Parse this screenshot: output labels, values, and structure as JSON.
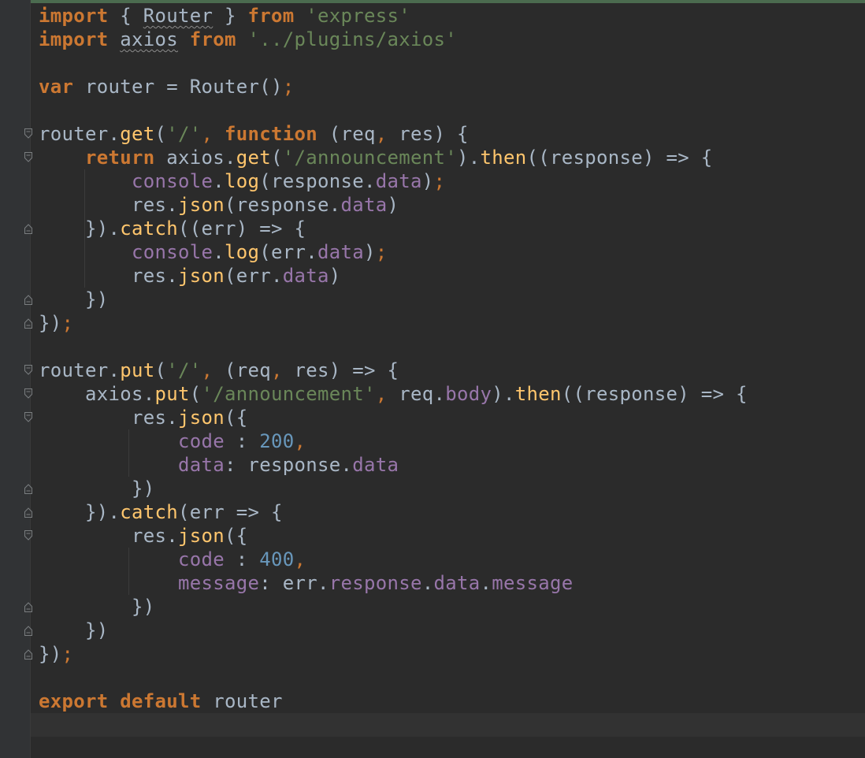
{
  "editor": {
    "lines": [
      [
        {
          "t": "import",
          "c": "kw"
        },
        {
          "t": " { "
        },
        {
          "t": "Router",
          "c": "typo"
        },
        {
          "t": " } "
        },
        {
          "t": "from",
          "c": "kw"
        },
        {
          "t": " "
        },
        {
          "t": "'express'",
          "c": "str"
        }
      ],
      [
        {
          "t": "import",
          "c": "kw"
        },
        {
          "t": " "
        },
        {
          "t": "axios",
          "c": "typo"
        },
        {
          "t": " "
        },
        {
          "t": "from",
          "c": "kw"
        },
        {
          "t": " "
        },
        {
          "t": "'../plugins/axios'",
          "c": "str"
        }
      ],
      [],
      [
        {
          "t": "var",
          "c": "kw"
        },
        {
          "t": " router = Router()"
        },
        {
          "t": ";",
          "c": "kwp"
        }
      ],
      [],
      [
        {
          "t": "router."
        },
        {
          "t": "get",
          "c": "fn"
        },
        {
          "t": "("
        },
        {
          "t": "'/'",
          "c": "str"
        },
        {
          "t": ", ",
          "c": "kwp"
        },
        {
          "t": "function",
          "c": "kw"
        },
        {
          "t": " (req"
        },
        {
          "t": ",",
          "c": "kwp"
        },
        {
          "t": " res) {"
        }
      ],
      [
        {
          "t": "    "
        },
        {
          "t": "return",
          "c": "kw"
        },
        {
          "t": " axios."
        },
        {
          "t": "get",
          "c": "fn"
        },
        {
          "t": "("
        },
        {
          "t": "'/announcement'",
          "c": "str"
        },
        {
          "t": ")."
        },
        {
          "t": "then",
          "c": "fn"
        },
        {
          "t": "((response) => {"
        }
      ],
      [
        {
          "t": "        "
        },
        {
          "t": "console",
          "c": "prop"
        },
        {
          "t": "."
        },
        {
          "t": "log",
          "c": "fn"
        },
        {
          "t": "(response."
        },
        {
          "t": "data",
          "c": "prop"
        },
        {
          "t": ")"
        },
        {
          "t": ";",
          "c": "kwp"
        }
      ],
      [
        {
          "t": "        res."
        },
        {
          "t": "json",
          "c": "fn"
        },
        {
          "t": "(response."
        },
        {
          "t": "data",
          "c": "prop"
        },
        {
          "t": ")"
        }
      ],
      [
        {
          "t": "    })."
        },
        {
          "t": "catch",
          "c": "fn"
        },
        {
          "t": "((err) => {"
        }
      ],
      [
        {
          "t": "        "
        },
        {
          "t": "console",
          "c": "prop"
        },
        {
          "t": "."
        },
        {
          "t": "log",
          "c": "fn"
        },
        {
          "t": "(err."
        },
        {
          "t": "data",
          "c": "prop"
        },
        {
          "t": ")"
        },
        {
          "t": ";",
          "c": "kwp"
        }
      ],
      [
        {
          "t": "        res."
        },
        {
          "t": "json",
          "c": "fn"
        },
        {
          "t": "(err."
        },
        {
          "t": "data",
          "c": "prop"
        },
        {
          "t": ")"
        }
      ],
      [
        {
          "t": "    })"
        }
      ],
      [
        {
          "t": "})"
        },
        {
          "t": ";",
          "c": "kwp"
        }
      ],
      [],
      [
        {
          "t": "router."
        },
        {
          "t": "put",
          "c": "fn"
        },
        {
          "t": "("
        },
        {
          "t": "'/'",
          "c": "str"
        },
        {
          "t": ", ",
          "c": "kwp"
        },
        {
          "t": "(req"
        },
        {
          "t": ",",
          "c": "kwp"
        },
        {
          "t": " res) => {"
        }
      ],
      [
        {
          "t": "    axios."
        },
        {
          "t": "put",
          "c": "fn"
        },
        {
          "t": "("
        },
        {
          "t": "'/announcement'",
          "c": "str"
        },
        {
          "t": ", ",
          "c": "kwp"
        },
        {
          "t": "req."
        },
        {
          "t": "body",
          "c": "prop"
        },
        {
          "t": ")."
        },
        {
          "t": "then",
          "c": "fn"
        },
        {
          "t": "((response) => {"
        }
      ],
      [
        {
          "t": "        res."
        },
        {
          "t": "json",
          "c": "fn"
        },
        {
          "t": "({"
        }
      ],
      [
        {
          "t": "            "
        },
        {
          "t": "code",
          "c": "prop"
        },
        {
          "t": " : "
        },
        {
          "t": "200",
          "c": "num"
        },
        {
          "t": ",",
          "c": "kwp"
        }
      ],
      [
        {
          "t": "            "
        },
        {
          "t": "data",
          "c": "prop"
        },
        {
          "t": ": response."
        },
        {
          "t": "data",
          "c": "prop"
        }
      ],
      [
        {
          "t": "        })"
        }
      ],
      [
        {
          "t": "    })."
        },
        {
          "t": "catch",
          "c": "fn"
        },
        {
          "t": "(err => {"
        }
      ],
      [
        {
          "t": "        res."
        },
        {
          "t": "json",
          "c": "fn"
        },
        {
          "t": "({"
        }
      ],
      [
        {
          "t": "            "
        },
        {
          "t": "code",
          "c": "prop"
        },
        {
          "t": " : "
        },
        {
          "t": "400",
          "c": "num"
        },
        {
          "t": ",",
          "c": "kwp"
        }
      ],
      [
        {
          "t": "            "
        },
        {
          "t": "message",
          "c": "prop"
        },
        {
          "t": ": err."
        },
        {
          "t": "response",
          "c": "prop"
        },
        {
          "t": "."
        },
        {
          "t": "data",
          "c": "prop"
        },
        {
          "t": "."
        },
        {
          "t": "message",
          "c": "prop"
        }
      ],
      [
        {
          "t": "        })"
        }
      ],
      [
        {
          "t": "    })"
        }
      ],
      [
        {
          "t": "})"
        },
        {
          "t": ";",
          "c": "kwp"
        }
      ],
      [],
      [
        {
          "t": "export",
          "c": "kw"
        },
        {
          "t": " "
        },
        {
          "t": "default",
          "c": "kw"
        },
        {
          "t": " router"
        }
      ],
      []
    ],
    "fold_markers": [
      {
        "line": 6,
        "kind": "open"
      },
      {
        "line": 7,
        "kind": "open"
      },
      {
        "line": 10,
        "kind": "close"
      },
      {
        "line": 13,
        "kind": "close"
      },
      {
        "line": 14,
        "kind": "close"
      },
      {
        "line": 16,
        "kind": "open"
      },
      {
        "line": 17,
        "kind": "open"
      },
      {
        "line": 18,
        "kind": "open"
      },
      {
        "line": 21,
        "kind": "close"
      },
      {
        "line": 22,
        "kind": "close"
      },
      {
        "line": 23,
        "kind": "open"
      },
      {
        "line": 26,
        "kind": "close"
      },
      {
        "line": 27,
        "kind": "close"
      },
      {
        "line": 28,
        "kind": "close"
      }
    ]
  },
  "colors": {
    "background": "#2b2b2b",
    "gutter": "#313335",
    "keyword": "#cc7832",
    "string": "#6a8759",
    "number": "#6897bb",
    "property": "#9876aa",
    "function": "#ffc66d",
    "text": "#a9b7c6",
    "current_line": "#323232"
  }
}
